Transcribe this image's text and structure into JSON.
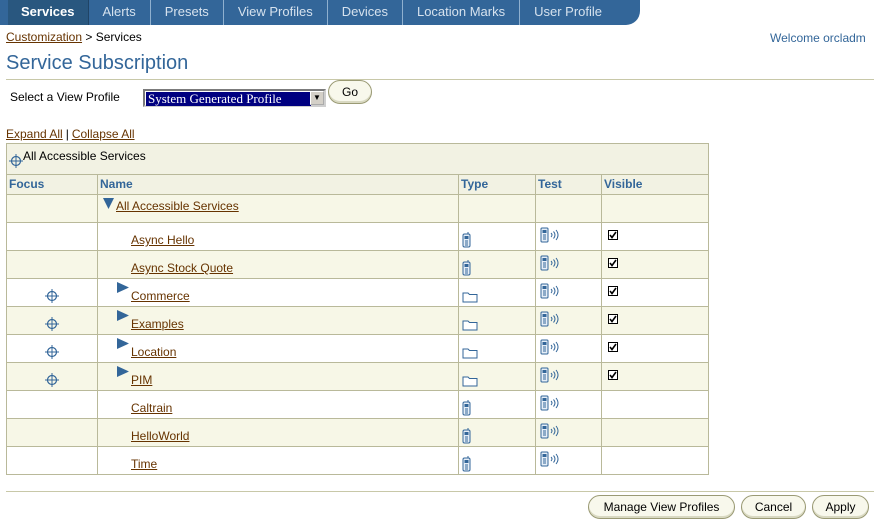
{
  "tabs": [
    {
      "label": "Services",
      "active": true
    },
    {
      "label": "Alerts"
    },
    {
      "label": "Presets"
    },
    {
      "label": "View Profiles"
    },
    {
      "label": "Devices"
    },
    {
      "label": "Location Marks"
    },
    {
      "label": "User Profile"
    }
  ],
  "breadcrumb": {
    "link": "Customization",
    "separator": ">",
    "current": "Services"
  },
  "welcome": "Welcome orcladm",
  "page_title": "Service Subscription",
  "view_profile": {
    "label": "Select a View Profile",
    "selected": "System Generated Profile",
    "go_label": "Go"
  },
  "expand_all": "Expand All",
  "collapse_all": "Collapse All",
  "tree_root": "All Accessible Services",
  "columns": {
    "focus": "Focus",
    "name": "Name",
    "type": "Type",
    "test": "Test",
    "visible": "Visible"
  },
  "rows": [
    {
      "name": "All Accessible Services",
      "level": 0,
      "node": "expanded",
      "focus": false,
      "type": "",
      "test": false,
      "visible": null
    },
    {
      "name": "Async Hello",
      "level": 1,
      "node": "leaf",
      "focus": false,
      "type": "service",
      "test": true,
      "visible": true
    },
    {
      "name": "Async Stock Quote",
      "level": 1,
      "node": "leaf",
      "focus": false,
      "type": "service",
      "test": true,
      "visible": true
    },
    {
      "name": "Commerce",
      "level": 1,
      "node": "collapsed",
      "focus": true,
      "type": "folder",
      "test": true,
      "visible": true
    },
    {
      "name": "Examples",
      "level": 1,
      "node": "collapsed",
      "focus": true,
      "type": "folder",
      "test": true,
      "visible": true
    },
    {
      "name": "Location",
      "level": 1,
      "node": "collapsed",
      "focus": true,
      "type": "folder",
      "test": true,
      "visible": true
    },
    {
      "name": "PIM",
      "level": 1,
      "node": "collapsed",
      "focus": true,
      "type": "folder",
      "test": true,
      "visible": true
    },
    {
      "name": "Caltrain",
      "level": 1,
      "node": "leaf",
      "focus": false,
      "type": "service",
      "test": true,
      "visible": null
    },
    {
      "name": "HelloWorld",
      "level": 1,
      "node": "leaf",
      "focus": false,
      "type": "service",
      "test": true,
      "visible": null
    },
    {
      "name": "Time",
      "level": 1,
      "node": "leaf",
      "focus": false,
      "type": "service",
      "test": true,
      "visible": null
    }
  ],
  "buttons": {
    "manage": "Manage View Profiles",
    "cancel": "Cancel",
    "apply": "Apply"
  },
  "colors": {
    "tab_bar": "#336699",
    "link": "#663300",
    "header_text": "#336699",
    "row_alt": "#f7f7e7"
  }
}
